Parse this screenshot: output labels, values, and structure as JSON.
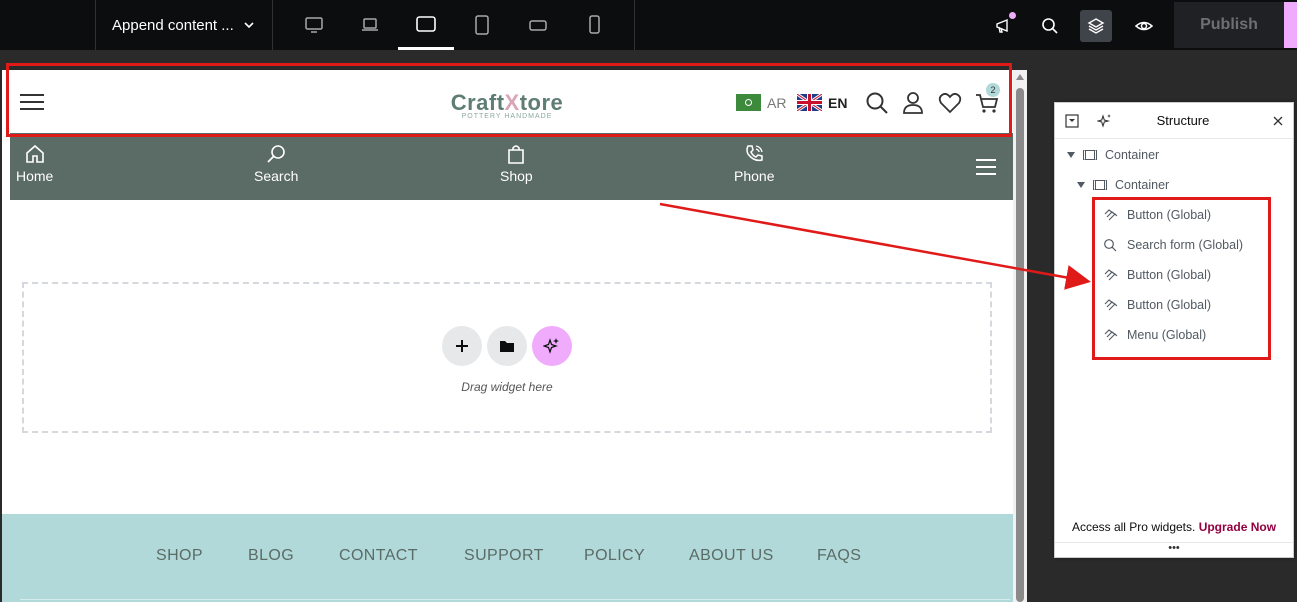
{
  "topbar": {
    "document_title": "Append content ...",
    "publish_label": "Publish"
  },
  "header": {
    "logo_brand_part1": "Craft",
    "logo_brand_x": "X",
    "logo_brand_part2": "tore",
    "logo_tagline": "POTTERY HANDMADE",
    "lang_ar": "AR",
    "lang_en": "EN",
    "cart_count": "2"
  },
  "nav": {
    "items": [
      {
        "label": "Home",
        "icon": "home-icon"
      },
      {
        "label": "Search",
        "icon": "search-icon"
      },
      {
        "label": "Shop",
        "icon": "shopping-bag-icon"
      },
      {
        "label": "Phone",
        "icon": "phone-icon"
      }
    ]
  },
  "dropzone": {
    "hint": "Drag widget here"
  },
  "footer": {
    "links": [
      "SHOP",
      "BLOG",
      "CONTACT",
      "SUPPORT",
      "POLICY",
      "ABOUT US",
      "FAQS"
    ]
  },
  "structure_panel": {
    "title": "Structure",
    "tree": [
      {
        "label": "Container",
        "level": 0
      },
      {
        "label": "Container",
        "level": 1
      },
      {
        "label": "Button (Global)",
        "level": 2,
        "icon": "button-icon"
      },
      {
        "label": "Search form (Global)",
        "level": 2,
        "icon": "search-icon"
      },
      {
        "label": "Button (Global)",
        "level": 2,
        "icon": "button-icon"
      },
      {
        "label": "Button (Global)",
        "level": 2,
        "icon": "button-icon"
      },
      {
        "label": "Menu (Global)",
        "level": 2,
        "icon": "button-icon"
      }
    ],
    "footer_text": "Access all Pro widgets.",
    "footer_link": "Upgrade Now",
    "dots": "•••"
  },
  "colors": {
    "nav_bg": "#5b6b66",
    "footer_bg": "#b1d9d9",
    "highlight": "#e01919",
    "accent_pink": "#f0abfc"
  }
}
